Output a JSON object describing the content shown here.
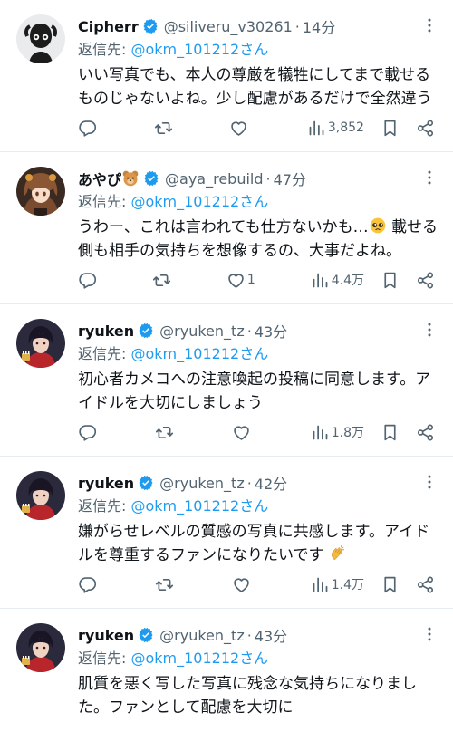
{
  "tweets": [
    {
      "name": "Cipherr",
      "handle": "@siliveru_v30261",
      "dot": "·",
      "time": "14分",
      "reply_prefix": "返信先: ",
      "reply_mention": "@okm_101212さん",
      "text": "いい写真でも、本人の尊厳を犠牲にしてまで載せるものじゃないよね。少し配慮があるだけで全然違う",
      "like_count": "",
      "view_count": "3,852",
      "avatar_icon": "cipherr-avatar",
      "accent": "#1d9bf0"
    },
    {
      "name": "あやぴ",
      "handle": "@aya_rebuild",
      "dot": "·",
      "time": "47分",
      "reply_prefix": "返信先: ",
      "reply_mention": "@okm_101212さん",
      "text_a": "うわー、これは言われても仕方ないかも…",
      "text_b": " 載せる側も相手の気持ちを想像するの、大事だよね。",
      "like_count": "1",
      "view_count": "4.4万",
      "avatar_icon": "anime-girl-avatar"
    },
    {
      "name": "ryuken",
      "handle": "@ryuken_tz",
      "dot": "·",
      "time": "43分",
      "reply_prefix": "返信先: ",
      "reply_mention": "@okm_101212さん",
      "text": "初心者カメコへの注意喚起の投稿に同意します。アイドルを大切にしましょう",
      "like_count": "",
      "view_count": "1.8万",
      "avatar_icon": "ryuken-avatar"
    },
    {
      "name": "ryuken",
      "handle": "@ryuken_tz",
      "dot": "·",
      "time": "42分",
      "reply_prefix": "返信先: ",
      "reply_mention": "@okm_101212さん",
      "text": "嫌がらせレベルの質感の写真に共感します。アイドルを尊重するファンになりたいです ",
      "like_count": "",
      "view_count": "1.4万",
      "avatar_icon": "ryuken-avatar"
    },
    {
      "name": "ryuken",
      "handle": "@ryuken_tz",
      "dot": "·",
      "time": "43分",
      "reply_prefix": "返信先: ",
      "reply_mention": "@okm_101212さん",
      "text": "肌質を悪く写した写真に残念な気持ちになりました。ファンとして配慮を大切に",
      "avatar_icon": "ryuken-avatar"
    }
  ]
}
